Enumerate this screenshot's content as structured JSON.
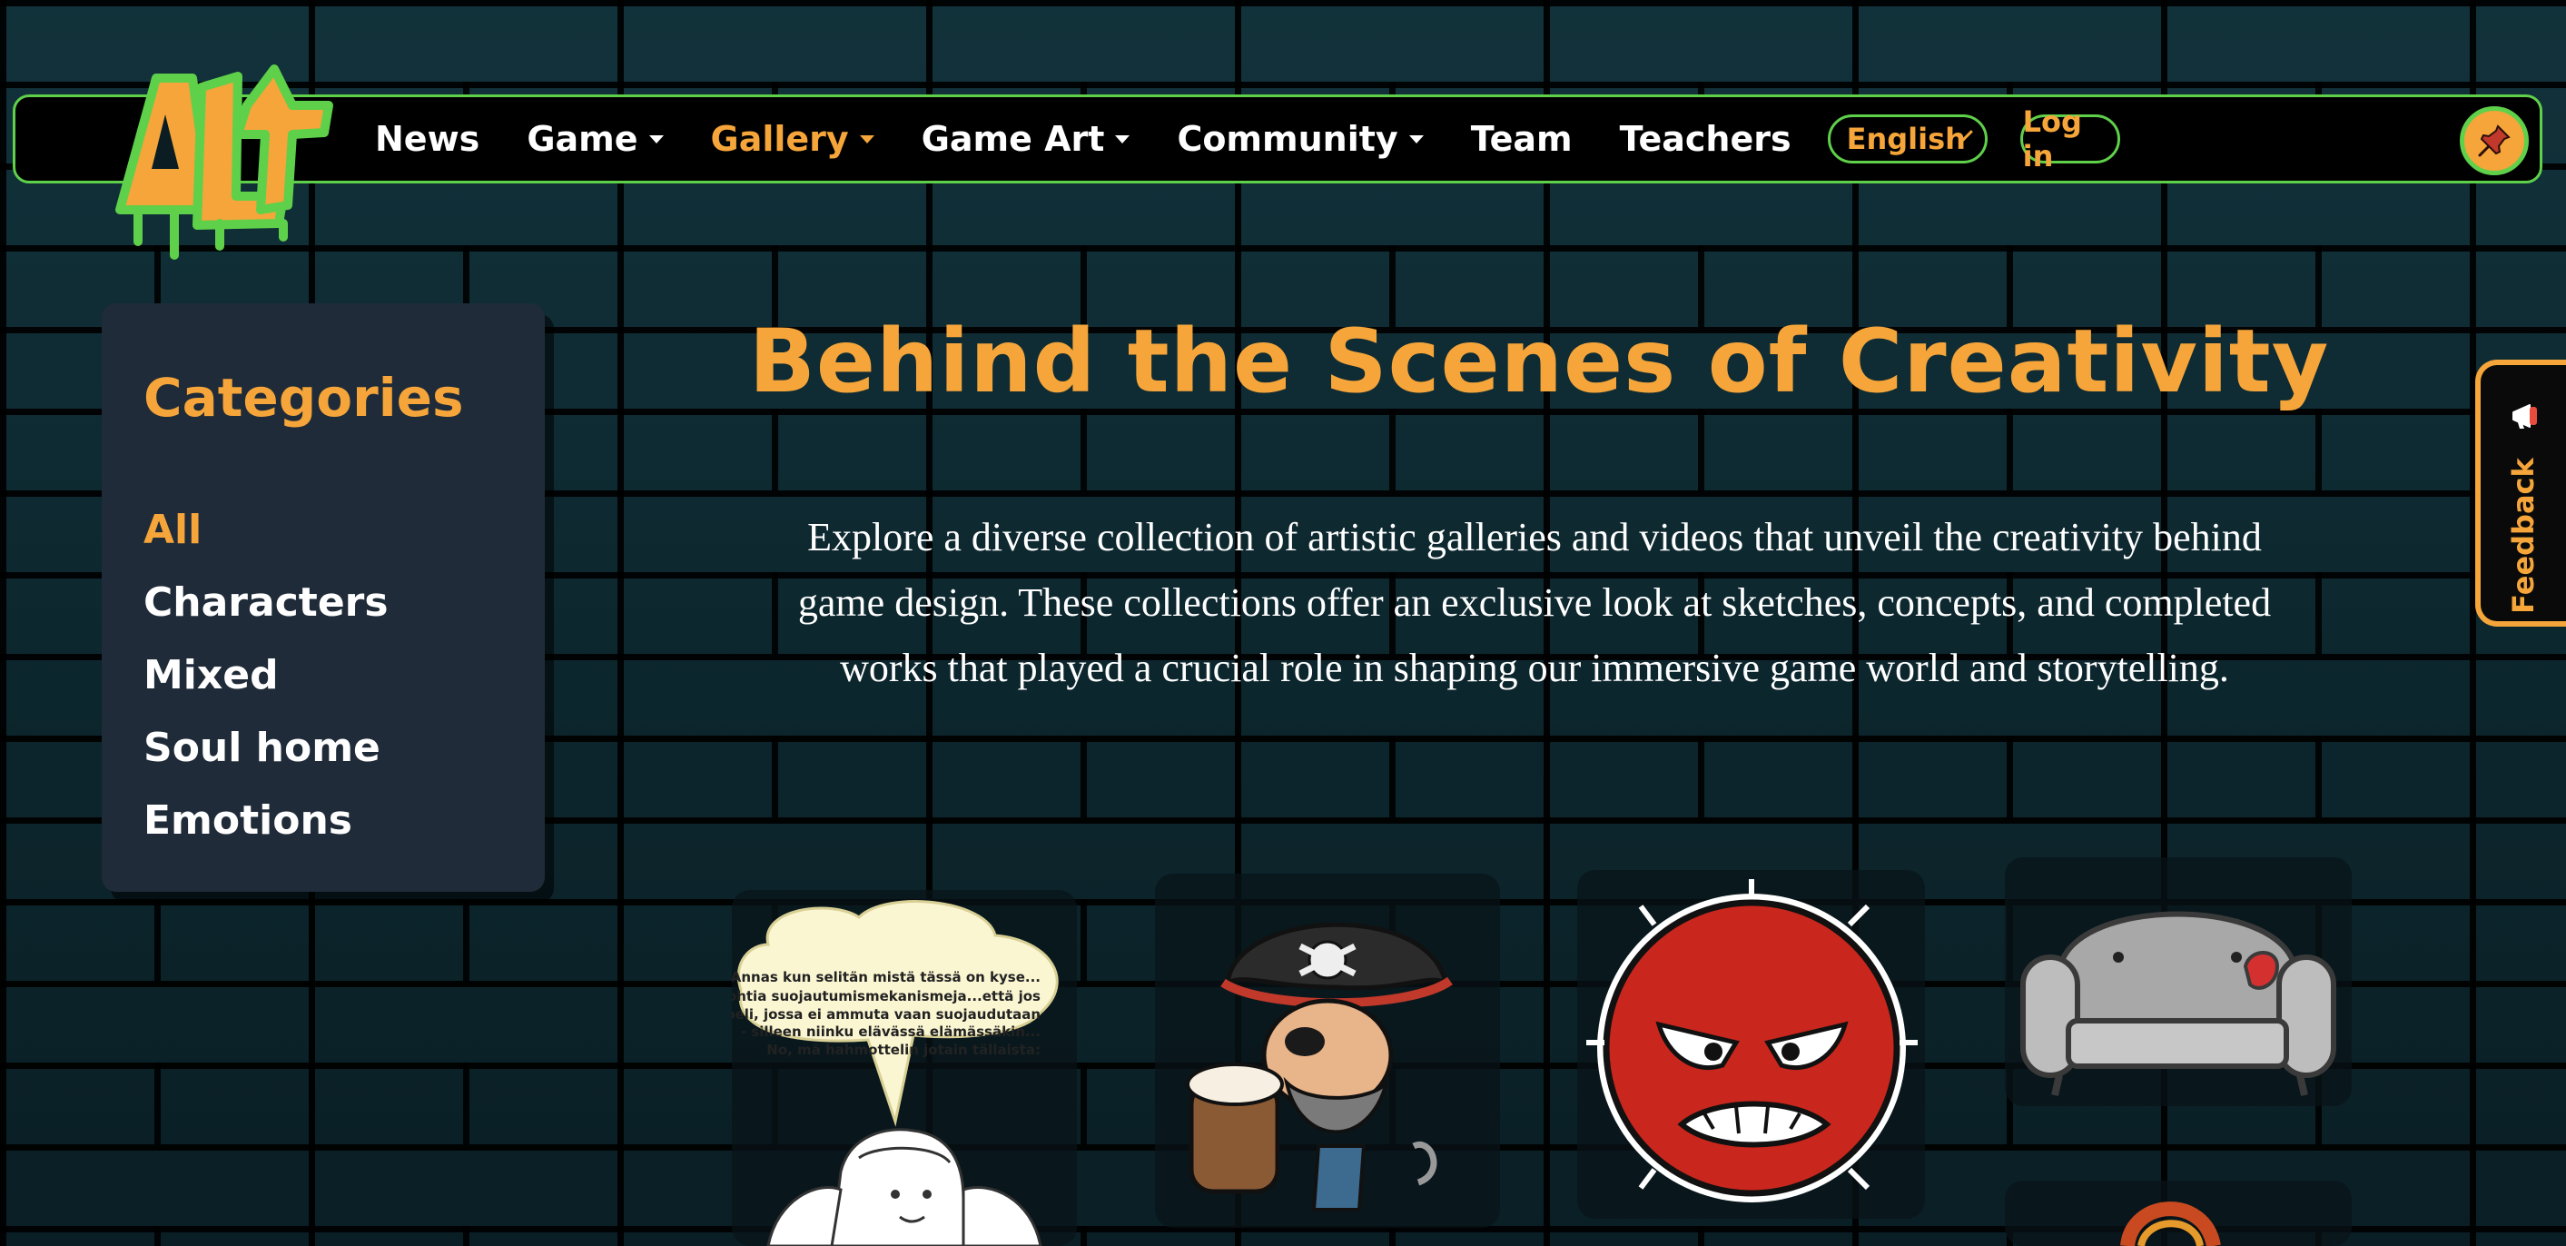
{
  "brand": {
    "logo_text": "ALT"
  },
  "nav": {
    "items": [
      {
        "label": "News",
        "has_caret": false,
        "active": false
      },
      {
        "label": "Game",
        "has_caret": true,
        "active": false
      },
      {
        "label": "Gallery",
        "has_caret": true,
        "active": true
      },
      {
        "label": "Game Art",
        "has_caret": true,
        "active": false
      },
      {
        "label": "Community",
        "has_caret": true,
        "active": false
      },
      {
        "label": "Team",
        "has_caret": false,
        "active": false
      },
      {
        "label": "Teachers",
        "has_caret": false,
        "active": false
      }
    ],
    "language": "English",
    "login_label": "Log in",
    "pin_icon": "pushpin-icon"
  },
  "sidebar": {
    "title": "Categories",
    "categories": [
      "All",
      "Characters",
      "Mixed",
      "Soul home",
      "Emotions"
    ],
    "active_index": 0
  },
  "hero": {
    "title": "Behind the Scenes of Creativity",
    "description": "Explore a diverse collection of artistic galleries and videos that unveil the creativity behind game design. These collections offer an exclusive look at sketches, concepts, and completed works that played a crucial role in shaping our immersive game world and storytelling."
  },
  "feedback": {
    "label": "Feedback",
    "icon": "megaphone-icon"
  },
  "gallery": {
    "speech_bubble": {
      "line1": "Annas kun selitän mistä tässä on kyse...",
      "line2": "Aloin pohtia suojautumismekanismeja...että jos",
      "line3": "olisikin peli, jossa ei ammuta vaan suojaudutaan",
      "line4": "- silleen niinku elävässä elämässäkin...",
      "line5": "No, mä hahmottelin jotain tällaista:"
    },
    "items": [
      "comic-sketch",
      "pirate-with-mug",
      "angry-red-ball",
      "grey-sofa",
      "partial-item"
    ]
  },
  "colors": {
    "accent": "#f5a53a",
    "green": "#5fd04a",
    "panel": "#1f2b38",
    "nav_bg": "#000000"
  }
}
